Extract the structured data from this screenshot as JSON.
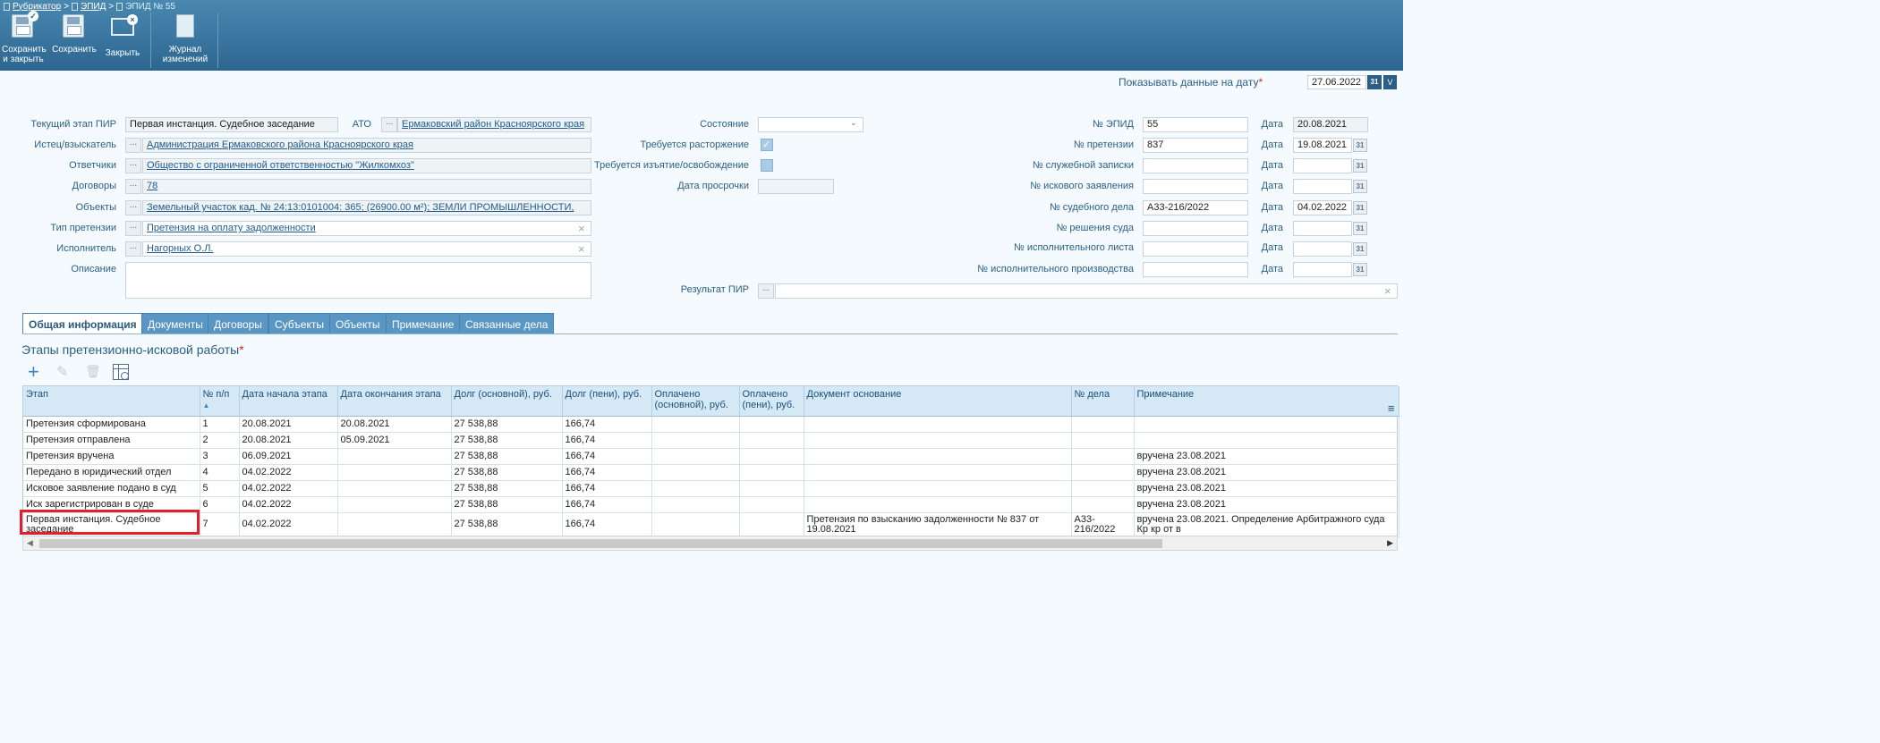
{
  "breadcrumb": {
    "root": "Рубрикатор",
    "mid": "ЭПИД",
    "current": "ЭПИД № 55",
    "sep": ">"
  },
  "toolbar": {
    "save_close": "Сохранить и закрыть",
    "save": "Сохранить",
    "close": "Закрыть",
    "journal": "Журнал изменений"
  },
  "date_filter": {
    "label": "Показывать данные на дату",
    "value": "27.06.2022",
    "cal_icon": "31",
    "dropdown_icon": "V"
  },
  "form": {
    "stage_label": "Текущий этап ПИР",
    "stage_value": "Первая инстанция. Судебное заседание",
    "ato_label": "АТО",
    "ato_value": "Ермаковский район Красноярского края",
    "plaintiff_label": "Истец/взыскатель",
    "plaintiff_value": "Администрация Ермаковского района Красноярского края",
    "defendants_label": "Ответчики",
    "defendants_value": "Общество с ограниченной ответственностью \"Жилкомхоз\"",
    "contracts_label": "Договоры",
    "contracts_value": "78",
    "objects_label": "Объекты",
    "objects_value": "Земельный участок кад. № 24:13:0101004: 365; (26900.00 м²); ЗЕМЛИ ПРОМЫШЛЕННОСТИ,",
    "claim_type_label": "Тип претензии",
    "claim_type_value": "Претензия на оплату задолженности",
    "executor_label": "Исполнитель",
    "executor_value": "Нагорных О.Л.",
    "description_label": "Описание",
    "state_label": "Состояние",
    "termination_label": "Требуется расторжение",
    "seizure_label": "Требуется изъятие/освобождение",
    "overdue_label": "Дата просрочки",
    "result_label": "Результат ПИР",
    "epid_no_label": "№ ЭПИД",
    "epid_no_value": "55",
    "epid_date_label": "Дата",
    "epid_date_value": "20.08.2021",
    "claim_no_label": "№ претензии",
    "claim_no_value": "837",
    "claim_date_label": "Дата",
    "claim_date_value": "19.08.2021",
    "memo_no_label": "№ служебной записки",
    "memo_date_label": "Дата",
    "suit_no_label": "№ искового заявления",
    "suit_date_label": "Дата",
    "case_no_label": "№ судебного дела",
    "case_no_value": "А33-216/2022",
    "case_date_label": "Дата",
    "case_date_value": "04.02.2022",
    "decision_no_label": "№ решения суда",
    "decision_date_label": "Дата",
    "writ_no_label": "№ исполнительного листа",
    "writ_date_label": "Дата",
    "enf_no_label": "№ исполнительного производства",
    "enf_date_label": "Дата",
    "cal_icon": "31",
    "dots": "...",
    "clear": "×",
    "check": "✓"
  },
  "tabs": [
    "Общая информация",
    "Документы",
    "Договоры",
    "Субъекты",
    "Объекты",
    "Примечание",
    "Связанные дела"
  ],
  "section": {
    "title": "Этапы претензионно-исковой работы",
    "req": "*"
  },
  "grid_toolbar": {
    "add": "+",
    "edit": "✎",
    "delete": "🗑"
  },
  "table": {
    "columns": [
      "Этап",
      "№ п/п",
      "Дата начала этапа",
      "Дата окончания этапа",
      "Долг (основной), руб.",
      "Долг (пени), руб.",
      "Оплачено (основной), руб.",
      "Оплачено (пени), руб.",
      "Документ основание",
      "№ дела",
      "Примечание"
    ],
    "sort_icon": "▲",
    "menu_icon": "≡",
    "rows": [
      [
        "Претензия сформирована",
        "1",
        "20.08.2021",
        "20.08.2021",
        "27 538,88",
        "166,74",
        "",
        "",
        "",
        "",
        ""
      ],
      [
        "Претензия отправлена",
        "2",
        "20.08.2021",
        "05.09.2021",
        "27 538,88",
        "166,74",
        "",
        "",
        "",
        "",
        ""
      ],
      [
        "Претензия вручена",
        "3",
        "06.09.2021",
        "",
        "27 538,88",
        "166,74",
        "",
        "",
        "",
        "",
        "вручена 23.08.2021"
      ],
      [
        "Передано в юридический отдел",
        "4",
        "04.02.2022",
        "",
        "27 538,88",
        "166,74",
        "",
        "",
        "",
        "",
        "вручена 23.08.2021"
      ],
      [
        "Исковое заявление подано в суд",
        "5",
        "04.02.2022",
        "",
        "27 538,88",
        "166,74",
        "",
        "",
        "",
        "",
        "вручена 23.08.2021"
      ],
      [
        "Иск зарегистрирован в суде",
        "6",
        "04.02.2022",
        "",
        "27 538,88",
        "166,74",
        "",
        "",
        "",
        "",
        "вручена 23.08.2021"
      ],
      [
        "Первая инстанция. Судебное заседание",
        "7",
        "04.02.2022",
        "",
        "27 538,88",
        "166,74",
        "",
        "",
        "Претензия по взысканию задолженности № 837 от 19.08.2021",
        "А33-216/2022",
        "вручена 23.08.2021. Определение Арбитражного суда Кр кр от в"
      ]
    ]
  },
  "scroll": {
    "left": "◀",
    "right": "▶"
  },
  "colors": {
    "toolbar": "#2c6690",
    "accent": "#5a96c3",
    "highlight": "#e0202a",
    "label": "#2b5f86"
  }
}
